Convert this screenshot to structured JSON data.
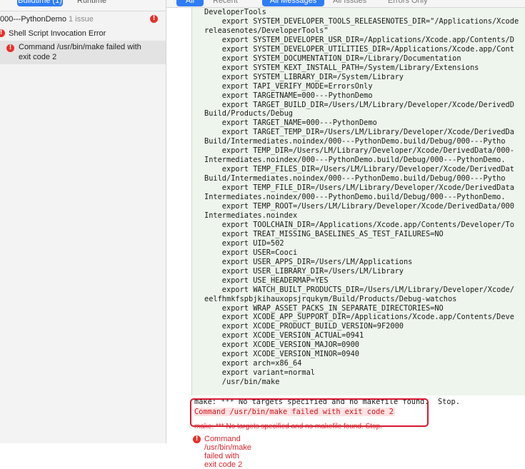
{
  "navigator": {
    "tabs": [
      {
        "label": "Buildtime (1)"
      },
      {
        "label": "Runtime"
      }
    ],
    "project": {
      "name": "000---PythonDemo",
      "count": "1 issue"
    },
    "group": {
      "label": "Shell Script Invocation Error"
    },
    "issue": {
      "line1": "Command /usr/bin/make failed with",
      "line2": "exit code 2"
    }
  },
  "filter_bar": {
    "scope_all": "All",
    "scope_recent": "Recent",
    "messages_all": "All Messages",
    "issues_all": "All Issues",
    "errors_only": "Errors Only"
  },
  "log_lines": [
    "DeveloperTools",
    "    export SYSTEM_DEVELOPER_TOOLS_RELEASENOTES_DIR=\"/Applications/Xcode",
    "releasenotes/DeveloperTools\"",
    "    export SYSTEM_DEVELOPER_USR_DIR=/Applications/Xcode.app/Contents/D",
    "    export SYSTEM_DEVELOPER_UTILITIES_DIR=/Applications/Xcode.app/Cont",
    "    export SYSTEM_DOCUMENTATION_DIR=/Library/Documentation",
    "    export SYSTEM_KEXT_INSTALL_PATH=/System/Library/Extensions",
    "    export SYSTEM_LIBRARY_DIR=/System/Library",
    "    export TAPI_VERIFY_MODE=ErrorsOnly",
    "    export TARGETNAME=000---PythonDemo",
    "    export TARGET_BUILD_DIR=/Users/LM/Library/Developer/Xcode/DerivedD",
    "Build/Products/Debug",
    "    export TARGET_NAME=000---PythonDemo",
    "    export TARGET_TEMP_DIR=/Users/LM/Library/Developer/Xcode/DerivedDa",
    "Build/Intermediates.noindex/000---PythonDemo.build/Debug/000---Pytho",
    "    export TEMP_DIR=/Users/LM/Library/Developer/Xcode/DerivedData/000-",
    "Intermediates.noindex/000---PythonDemo.build/Debug/000---PythonDemo.",
    "    export TEMP_FILES_DIR=/Users/LM/Library/Developer/Xcode/DerivedDat",
    "Build/Intermediates.noindex/000---PythonDemo.build/Debug/000---Pytho",
    "    export TEMP_FILE_DIR=/Users/LM/Library/Developer/Xcode/DerivedData",
    "Intermediates.noindex/000---PythonDemo.build/Debug/000---PythonDemo.",
    "    export TEMP_ROOT=/Users/LM/Library/Developer/Xcode/DerivedData/000",
    "Intermediates.noindex",
    "    export TOOLCHAIN_DIR=/Applications/Xcode.app/Contents/Developer/To",
    "    export TREAT_MISSING_BASELINES_AS_TEST_FAILURES=NO",
    "    export UID=502",
    "    export USER=Cooci",
    "    export USER_APPS_DIR=/Users/LM/Applications",
    "    export USER_LIBRARY_DIR=/Users/LM/Library",
    "    export USE_HEADERMAP=YES",
    "    export WATCH_BUILT_PRODUCTS_DIR=/Users/LM/Library/Developer/Xcode/",
    "eelfhmkfspbjkihauxopsjrqukym/Build/Products/Debug-watchos",
    "    export WRAP_ASSET_PACKS_IN_SEPARATE_DIRECTORIES=NO",
    "    export XCODE_APP_SUPPORT_DIR=/Applications/Xcode.app/Contents/Deve",
    "    export XCODE_PRODUCT_BUILD_VERSION=9F2000",
    "    export XCODE_VERSION_ACTUAL=0941",
    "    export XCODE_VERSION_MAJOR=0900",
    "    export XCODE_VERSION_MINOR=0940",
    "    export arch=x86_64",
    "    export variant=normal",
    "    /usr/bin/make"
  ],
  "output": {
    "make_msg": "make: *** No targets specified and no makefile found.  Stop.",
    "command_failed": "Command /usr/bin/make failed with exit code 2"
  },
  "summary": {
    "make_msg": "make: *** No targets specified and no makefile found.  Stop.",
    "command_failed": "Command /usr/bin/make failed with exit code 2"
  },
  "colors": {
    "accent": "#2f7df6",
    "error": "#e8302a",
    "highlight_box": "#d7192f",
    "log_background": "#eef5ec"
  }
}
